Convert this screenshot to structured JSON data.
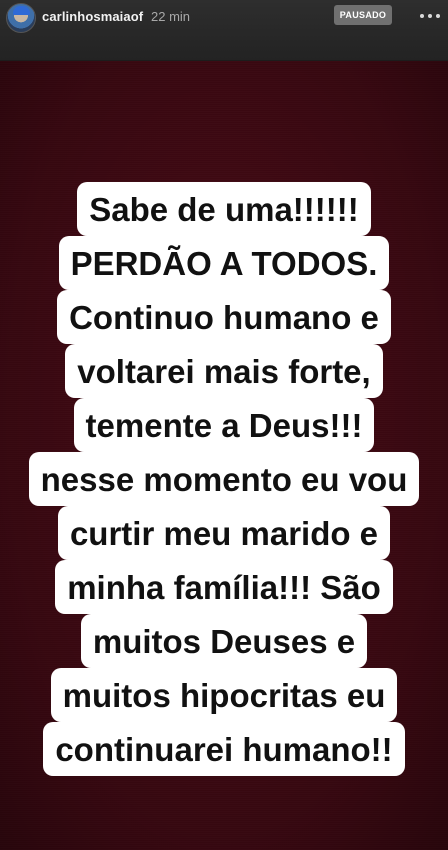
{
  "header": {
    "username": "carlinhosmaiaof",
    "time": "22 min",
    "status_badge": "PAUSADO"
  },
  "story": {
    "background_color": "#480a15",
    "text_lines": [
      "Sabe de uma!!!!!!",
      "PERDÃO A TODOS.",
      "Continuo humano e",
      "voltarei mais forte,",
      "temente a Deus!!!",
      "nesse momento eu vou",
      "curtir meu marido e",
      "minha família!!! São",
      "muitos Deuses e",
      "muitos hipocritas eu",
      "continuarei humano!!"
    ]
  }
}
